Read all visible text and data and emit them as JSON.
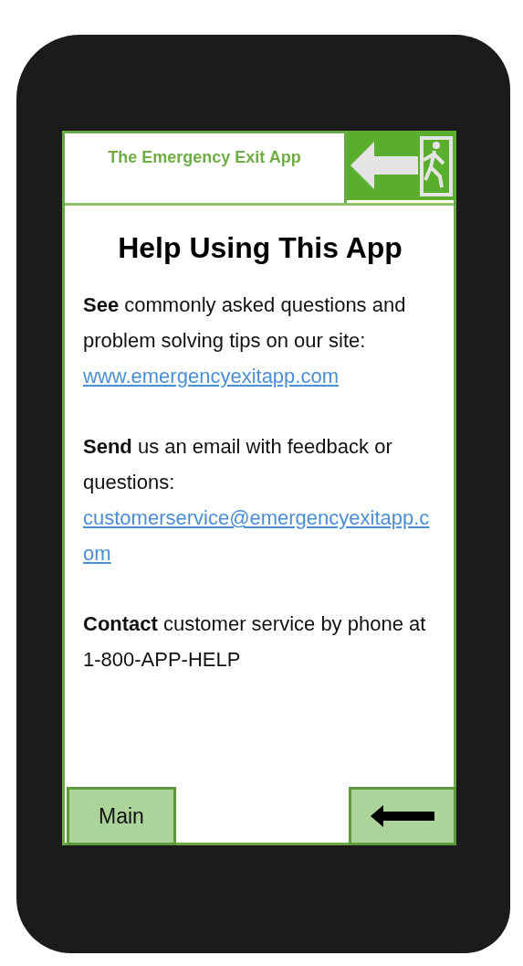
{
  "header": {
    "title": "The Emergency Exit App"
  },
  "heading": "Help Using This App",
  "sections": [
    {
      "text": "**See** commonly asked questions and problem solving tips on our site:",
      "link": "www.emergencyexitapp.com"
    },
    {
      "text": "**Send** us an email with feedback or questions:",
      "link": "customerservice@emergencyexitapp.com"
    },
    {
      "text": "**Contact** customer service by phone at 1-800-APP-HELP"
    }
  ],
  "buttons": {
    "main": "Main"
  }
}
